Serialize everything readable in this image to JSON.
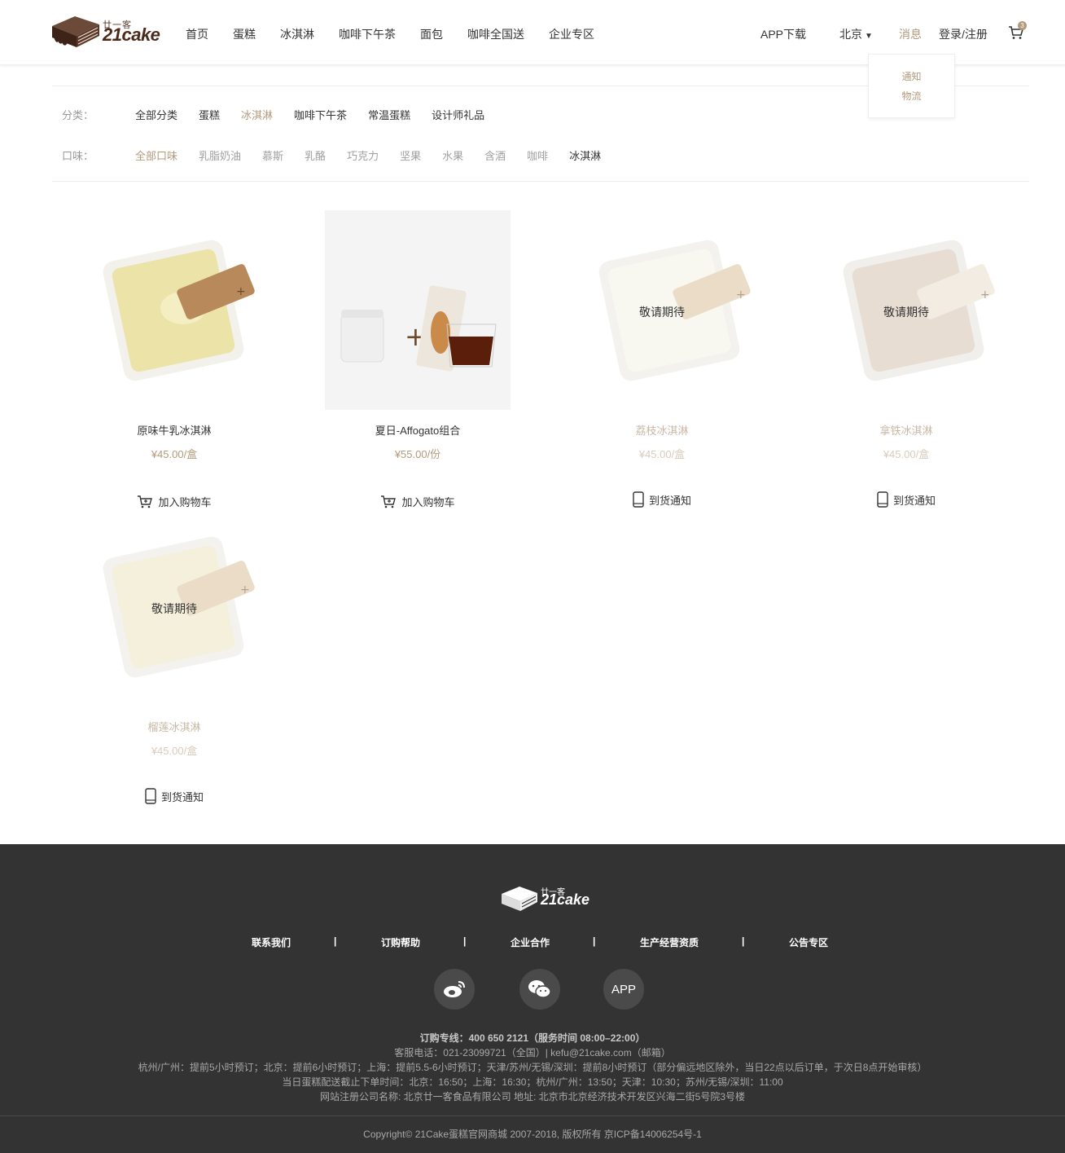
{
  "header": {
    "logo_small": "廿一客",
    "logo_big": "21cake",
    "nav": [
      "首页",
      "蛋糕",
      "冰淇淋",
      "咖啡下午茶",
      "面包",
      "咖啡全国送",
      "企业专区"
    ],
    "app_download": "APP下载",
    "city": "北京",
    "messages": "消息",
    "login": "登录/注册",
    "cart_count": "3"
  },
  "message_dropdown": [
    "通知",
    "物流"
  ],
  "filters": {
    "category_label": "分类：",
    "categories": [
      "全部分类",
      "蛋糕",
      "冰淇淋",
      "咖啡下午茶",
      "常温蛋糕",
      "设计师礼品"
    ],
    "flavor_label": "口味：",
    "flavors": [
      "全部口味",
      "乳脂奶油",
      "慕斯",
      "乳酪",
      "巧克力",
      "坚果",
      "水果",
      "含酒",
      "咖啡",
      "冰淇淋"
    ]
  },
  "products": [
    {
      "name": "原味牛乳冰淇淋",
      "price": "¥45.00/盒",
      "action": "加入购物车",
      "soon": ""
    },
    {
      "name": "夏日-Affogato组合",
      "price": "¥55.00/份",
      "action": "加入购物车",
      "soon": ""
    },
    {
      "name": "荔枝冰淇淋",
      "price": "¥45.00/盒",
      "action": "到货通知",
      "soon": "敬请期待"
    },
    {
      "name": "拿铁冰淇淋",
      "price": "¥45.00/盒",
      "action": "到货通知",
      "soon": "敬请期待"
    },
    {
      "name": "榴莲冰淇淋",
      "price": "¥45.00/盒",
      "action": "到货通知",
      "soon": "敬请期待"
    }
  ],
  "footer": {
    "logo_small": "廿一客",
    "logo_big": "21cake",
    "links": [
      "联系我们",
      "|",
      "订购帮助",
      "|",
      "企业合作",
      "|",
      "生产经营资质",
      "|",
      "公告专区"
    ],
    "app_label": "APP",
    "info": [
      "订购专线：400 650 2121（服务时间 08:00–22:00）",
      "客服电话：021-23099721（全国）| kefu@21cake.com（邮箱）",
      "杭州/广州：提前5小时预订；北京：提前6小时预订；上海：提前5.5-6小时预订；天津/苏州/无锡/深圳：提前8小时预订（部分偏远地区除外，当日22点以后订单，于次日8点开始审核）",
      "当日蛋糕配送截止下单时间：北京：16:50；上海：16:30；杭州/广州：13:50；天津：10:30；苏州/无锡/深圳：11:00",
      "网站注册公司名称: 北京廿一客食品有限公司 地址: 北京市北京经济技术开发区兴海二街5号院3号楼"
    ],
    "copyright": "Copyright© 21Cake蛋糕官网商城 2007-2018, 版权所有 京ICP备14006254号-1"
  },
  "colors": {
    "accent": "#b39a7c",
    "footer_bg": "#333333",
    "logo_brown": "#4a2a1a"
  }
}
